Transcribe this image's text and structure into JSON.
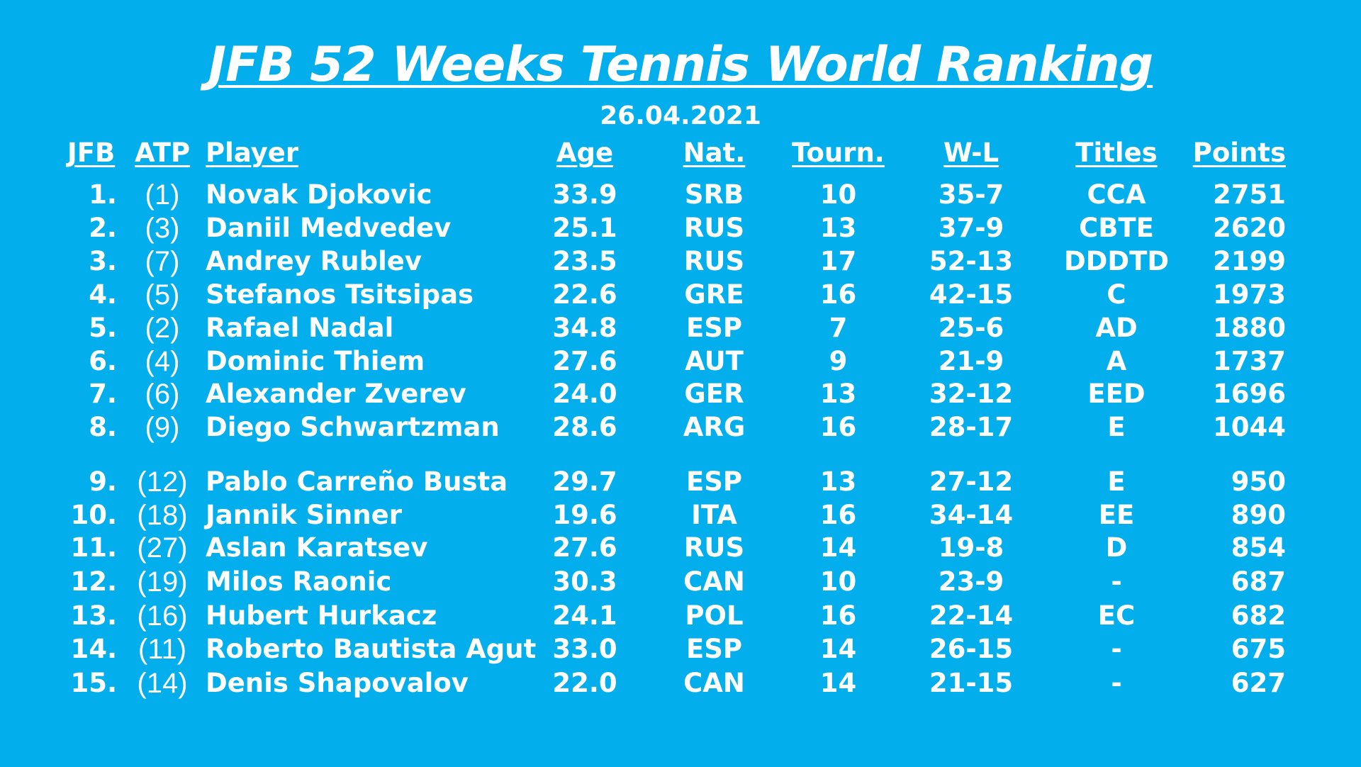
{
  "title": "JFB 52 Weeks Tennis World Ranking",
  "date": "26.04.2021",
  "headers": {
    "jfb": "JFB",
    "atp": "ATP",
    "player": "Player",
    "age": "Age",
    "nat": "Nat.",
    "tourn": "Tourn.",
    "wl": "W-L",
    "titles": "Titles",
    "points": "Points"
  },
  "rows": [
    {
      "jfb": "1.",
      "atp": "(1)",
      "player": "Novak Djokovic",
      "age": "33.9",
      "nat": "SRB",
      "tourn": "10",
      "wl": "35-7",
      "titles": "CCA",
      "points": "2751"
    },
    {
      "jfb": "2.",
      "atp": "(3)",
      "player": "Daniil Medvedev",
      "age": "25.1",
      "nat": "RUS",
      "tourn": "13",
      "wl": "37-9",
      "titles": "CBTE",
      "points": "2620"
    },
    {
      "jfb": "3.",
      "atp": "(7)",
      "player": "Andrey Rublev",
      "age": "23.5",
      "nat": "RUS",
      "tourn": "17",
      "wl": "52-13",
      "titles": "DDDTD",
      "points": "2199"
    },
    {
      "jfb": "4.",
      "atp": "(5)",
      "player": "Stefanos Tsitsipas",
      "age": "22.6",
      "nat": "GRE",
      "tourn": "16",
      "wl": "42-15",
      "titles": "C",
      "points": "1973"
    },
    {
      "jfb": "5.",
      "atp": "(2)",
      "player": "Rafael Nadal",
      "age": "34.8",
      "nat": "ESP",
      "tourn": "7",
      "wl": "25-6",
      "titles": "AD",
      "points": "1880"
    },
    {
      "jfb": "6.",
      "atp": "(4)",
      "player": "Dominic Thiem",
      "age": "27.6",
      "nat": "AUT",
      "tourn": "9",
      "wl": "21-9",
      "titles": "A",
      "points": "1737"
    },
    {
      "jfb": "7.",
      "atp": "(6)",
      "player": "Alexander Zverev",
      "age": "24.0",
      "nat": "GER",
      "tourn": "13",
      "wl": "32-12",
      "titles": "EED",
      "points": "1696"
    },
    {
      "jfb": "8.",
      "atp": "(9)",
      "player": "Diego Schwartzman",
      "age": "28.6",
      "nat": "ARG",
      "tourn": "16",
      "wl": "28-17",
      "titles": "E",
      "points": "1044"
    },
    {
      "jfb": "9.",
      "atp": "(12)",
      "player": "Pablo Carreño Busta",
      "age": "29.7",
      "nat": "ESP",
      "tourn": "13",
      "wl": "27-12",
      "titles": "E",
      "points": "950"
    },
    {
      "jfb": "10.",
      "atp": "(18)",
      "player": "Jannik Sinner",
      "age": "19.6",
      "nat": "ITA",
      "tourn": "16",
      "wl": "34-14",
      "titles": "EE",
      "points": "890"
    },
    {
      "jfb": "11.",
      "atp": "(27)",
      "player": "Aslan Karatsev",
      "age": "27.6",
      "nat": "RUS",
      "tourn": "14",
      "wl": "19-8",
      "titles": "D",
      "points": "854"
    },
    {
      "jfb": "12.",
      "atp": "(19)",
      "player": "Milos Raonic",
      "age": "30.3",
      "nat": "CAN",
      "tourn": "10",
      "wl": "23-9",
      "titles": "-",
      "points": "687"
    },
    {
      "jfb": "13.",
      "atp": "(16)",
      "player": "Hubert Hurkacz",
      "age": "24.1",
      "nat": "POL",
      "tourn": "16",
      "wl": "22-14",
      "titles": "EC",
      "points": "682"
    },
    {
      "jfb": "14.",
      "atp": "(11)",
      "player": "Roberto Bautista Agut",
      "age": "33.0",
      "nat": "ESP",
      "tourn": "14",
      "wl": "26-15",
      "titles": "-",
      "points": "675"
    },
    {
      "jfb": "15.",
      "atp": "(14)",
      "player": "Denis Shapovalov",
      "age": "22.0",
      "nat": "CAN",
      "tourn": "14",
      "wl": "21-15",
      "titles": "-",
      "points": "627"
    }
  ]
}
